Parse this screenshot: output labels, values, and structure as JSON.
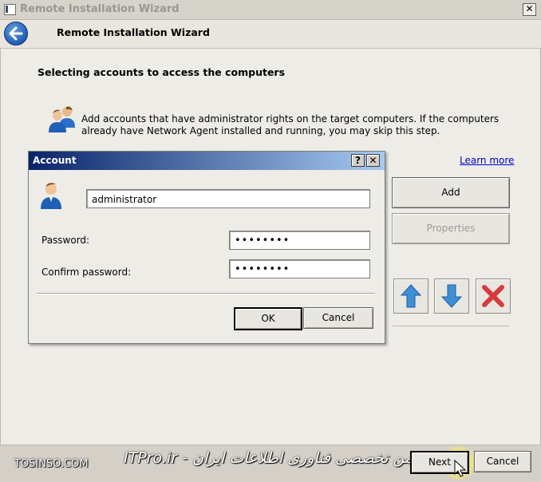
{
  "window": {
    "title": "Remote Installation Wizard",
    "close_glyph": "✕"
  },
  "header": {
    "back_icon": "back-arrow-icon",
    "heading": "Remote Installation Wizard"
  },
  "step": {
    "title": "Selecting accounts to access the computers",
    "description": "Add accounts that have administrator rights on the target computers. If the computers already have Network Agent installed and running, you may skip this step.",
    "learn_more": "Learn more"
  },
  "side_buttons": {
    "add": "Add",
    "properties": "Properties",
    "up_icon": "move-up-arrow-icon",
    "down_icon": "move-down-arrow-icon",
    "remove_icon": "remove-x-icon"
  },
  "footer": {
    "next": "Next",
    "cancel": "Cancel",
    "watermark_left": "TOSINSO.COM",
    "watermark_right": "ITPro.ir - انجمن تخصصی فناوری اطلاعات ایران"
  },
  "dialog": {
    "title": "Account",
    "help_glyph": "?",
    "close_glyph": "✕",
    "account_value": "administrator",
    "password_label": "Password:",
    "password_value": "••••••••",
    "confirm_label": "Confirm password:",
    "confirm_value": "••••••••",
    "ok": "OK",
    "cancel": "Cancel"
  },
  "colors": {
    "dialog_title_start": "#0a246a",
    "dialog_title_end": "#a6caf0",
    "link": "#0000cc",
    "arrow_blue": "#3d8fd6",
    "remove_red": "#d83a3a"
  }
}
